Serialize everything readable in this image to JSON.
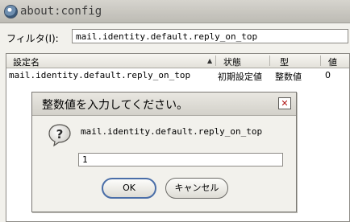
{
  "window": {
    "title": "about:config",
    "icon": "firefox-icon"
  },
  "filter": {
    "label": "フィルタ(I):",
    "value": "mail.identity.default.reply_on_top"
  },
  "columns": {
    "name": "設定名",
    "status": "状態",
    "type": "型",
    "value": "値"
  },
  "rows": [
    {
      "name": "mail.identity.default.reply_on_top",
      "status": "初期設定値",
      "type": "整数値",
      "value": "0"
    }
  ],
  "dialog": {
    "title": "整数値を入力してください。",
    "message": "mail.identity.default.reply_on_top",
    "input_value": "1",
    "ok_label": "OK",
    "cancel_label": "キャンセル",
    "icon": "question-icon",
    "close_icon": "close-icon"
  }
}
